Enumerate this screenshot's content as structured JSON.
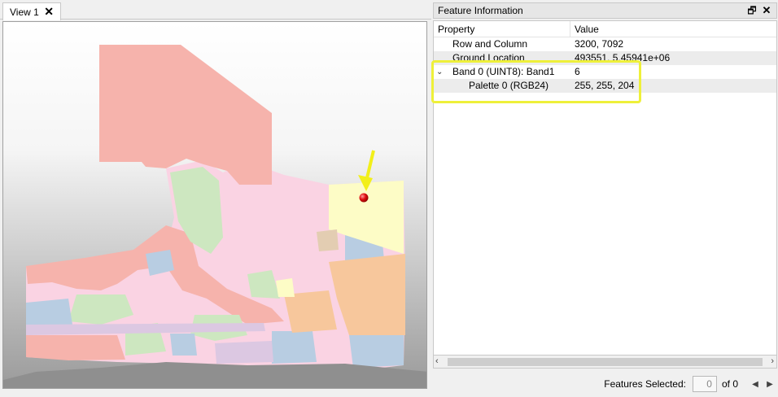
{
  "view": {
    "tab_label": "View 1",
    "close_glyph": "✕"
  },
  "feature_info": {
    "title": "Feature Information",
    "float_glyph": "🗗",
    "close_glyph": "✕",
    "columns": {
      "property": "Property",
      "value": "Value"
    },
    "rows": [
      {
        "property": "Row and Column",
        "value": "3200, 7092"
      },
      {
        "property": "Ground Location",
        "value": "493551, 5.45941e+06"
      },
      {
        "property": "Band 0 (UINT8): Band1",
        "value": "6",
        "expander": "⌄"
      },
      {
        "property": "Palette 0 (RGB24)",
        "value": "255, 255, 204"
      }
    ]
  },
  "scrollbar": {
    "left_arrow": "‹",
    "right_arrow": "›"
  },
  "status": {
    "features_selected_label": "Features Selected:",
    "selected_count": "0",
    "of_text": "of 0",
    "prev_arrow": "◀",
    "next_arrow": "▶"
  },
  "colors": {
    "highlight": "#eef03a",
    "marker": "#e01010",
    "arrow": "#f2ef1a",
    "map_pink": "#f6b3ac",
    "map_lightpink": "#fad3e3",
    "map_green": "#cde7c0",
    "map_blue": "#b8cde2",
    "map_orange": "#f7c79c",
    "map_yellow": "#fdfcc6",
    "map_lilac": "#dcc8e2"
  }
}
